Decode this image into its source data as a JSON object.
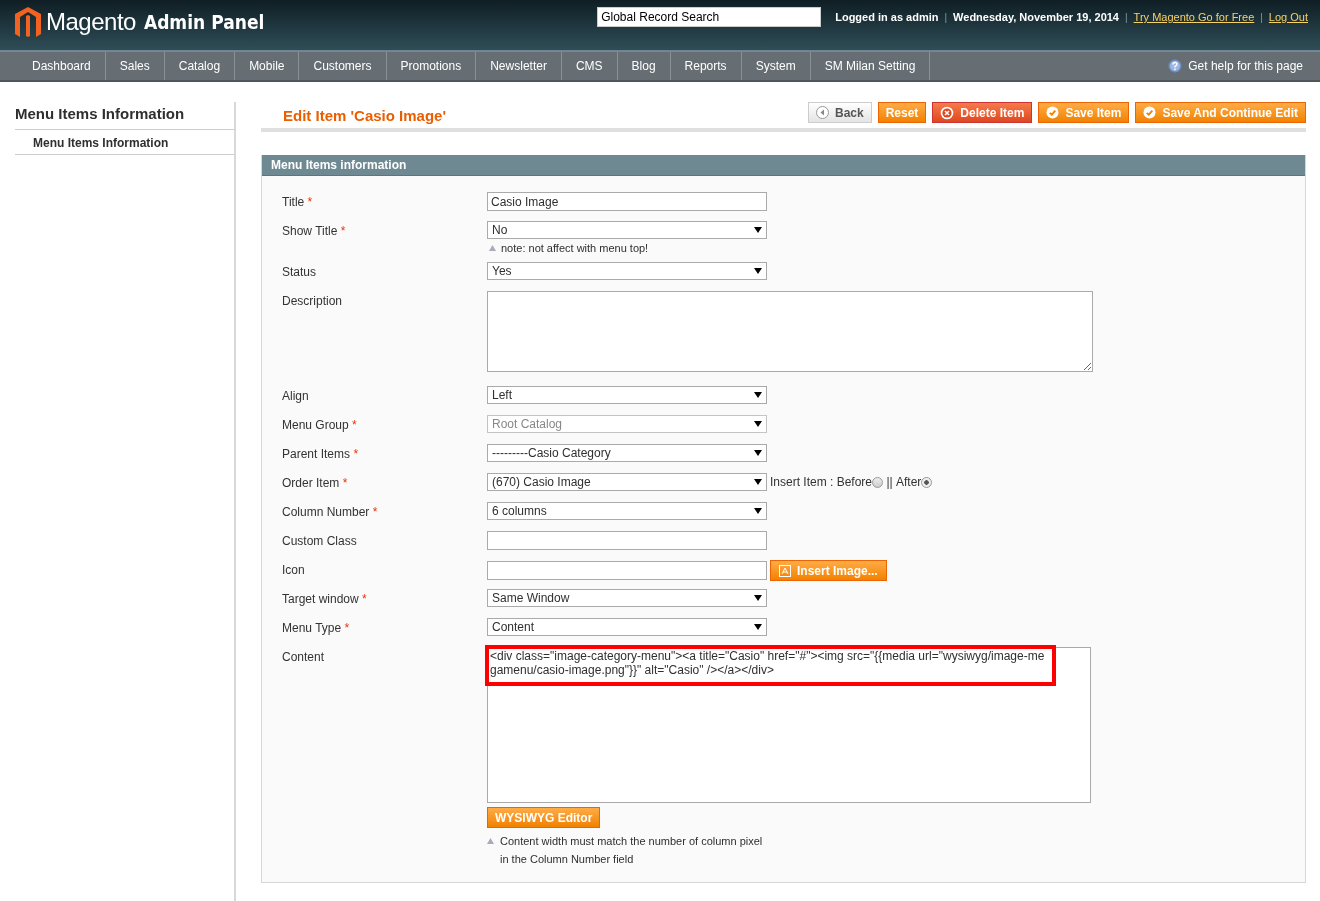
{
  "header": {
    "logo_text": "Magento",
    "logo_suffix": "Admin Panel",
    "search_value": "Global Record Search",
    "user": "Logged in as admin",
    "date": "Wednesday, November 19, 2014",
    "links": [
      "Try Magento Go for Free",
      "Log Out"
    ],
    "separators": [
      "|",
      "|",
      "|"
    ]
  },
  "nav": {
    "items": [
      {
        "label": "Dashboard",
        "selected": false
      },
      {
        "label": "Sales",
        "selected": false
      },
      {
        "label": "Catalog",
        "selected": false
      },
      {
        "label": "Mobile",
        "selected": false
      },
      {
        "label": "Customers",
        "selected": false
      },
      {
        "label": "Promotions",
        "selected": false
      },
      {
        "label": "Newsletter",
        "selected": false
      },
      {
        "label": "CMS",
        "selected": false
      },
      {
        "label": "Blog",
        "selected": false
      },
      {
        "label": "Reports",
        "selected": false
      },
      {
        "label": "System",
        "selected": false
      },
      {
        "label": "SM Milan Setting",
        "selected": false
      }
    ],
    "help": "Get help for this page"
  },
  "sidebar": {
    "title": "Menu Items Information",
    "tabs": [
      {
        "label": "Menu Items Information",
        "selected": true
      }
    ]
  },
  "page_title": "Edit Item 'Casio Image'",
  "buttons": [
    {
      "label": "Back",
      "kind": "back"
    },
    {
      "label": "Reset",
      "kind": "plain"
    },
    {
      "label": "Delete Item",
      "kind": "delete"
    },
    {
      "label": "Save Item",
      "kind": "save"
    },
    {
      "label": "Save And Continue Edit",
      "kind": "save"
    }
  ],
  "section": {
    "title": "Menu Items information",
    "required_mark": "*",
    "fields": [
      {
        "kind": "text",
        "label": "Title",
        "required": true,
        "value": "Casio Image",
        "disabled": false
      },
      {
        "kind": "select",
        "label": "Show Title",
        "required": true,
        "value": "No",
        "disabled": false,
        "note": "note: not affect with menu top!"
      },
      {
        "kind": "select",
        "label": "Status",
        "required": false,
        "value": "Yes",
        "disabled": false
      },
      {
        "kind": "textarea",
        "label": "Description",
        "required": false,
        "disabled": false
      },
      {
        "kind": "select",
        "label": "Align",
        "required": false,
        "value": "Left",
        "disabled": false
      },
      {
        "kind": "select",
        "label": "Menu Group",
        "required": true,
        "value": "Root Catalog",
        "disabled": true
      },
      {
        "kind": "select",
        "label": "Parent Items",
        "required": true,
        "value": "---------Casio Category",
        "disabled": false
      },
      {
        "kind": "order",
        "label": "Order Item",
        "required": true,
        "value": "(670) Casio Image",
        "disabled": false,
        "prefix": "Insert Item : ",
        "separator": "||",
        "options": [
          {
            "label": "Before",
            "selected": false
          },
          {
            "label": "After",
            "selected": true
          }
        ]
      },
      {
        "kind": "select",
        "label": "Column Number",
        "required": true,
        "value": "6 columns",
        "disabled": false
      },
      {
        "kind": "text",
        "label": "Custom Class",
        "required": false,
        "disabled": false
      },
      {
        "kind": "image",
        "label": "Icon",
        "required": false,
        "disabled": false,
        "button": "Insert Image..."
      },
      {
        "kind": "select",
        "label": "Target window",
        "required": true,
        "value": "Same Window",
        "disabled": false
      },
      {
        "kind": "select",
        "label": "Menu Type",
        "required": true,
        "value": "Content",
        "disabled": false
      },
      {
        "kind": "content",
        "label": "Content",
        "required": false,
        "disabled": false,
        "value": "<div class=\"image-category-menu\"><a title=\"Casio\" href=\"#\"><img src=\"{{media url=\"wysiwyg/image-megamenu/casio-image.png\"}}\" alt=\"Casio\" /></a></div>",
        "highlighted": true,
        "button": "WYSIWYG Editor",
        "note_lines": [
          "Content width must match the number of column pixel",
          "in the Column Number field"
        ]
      }
    ]
  }
}
